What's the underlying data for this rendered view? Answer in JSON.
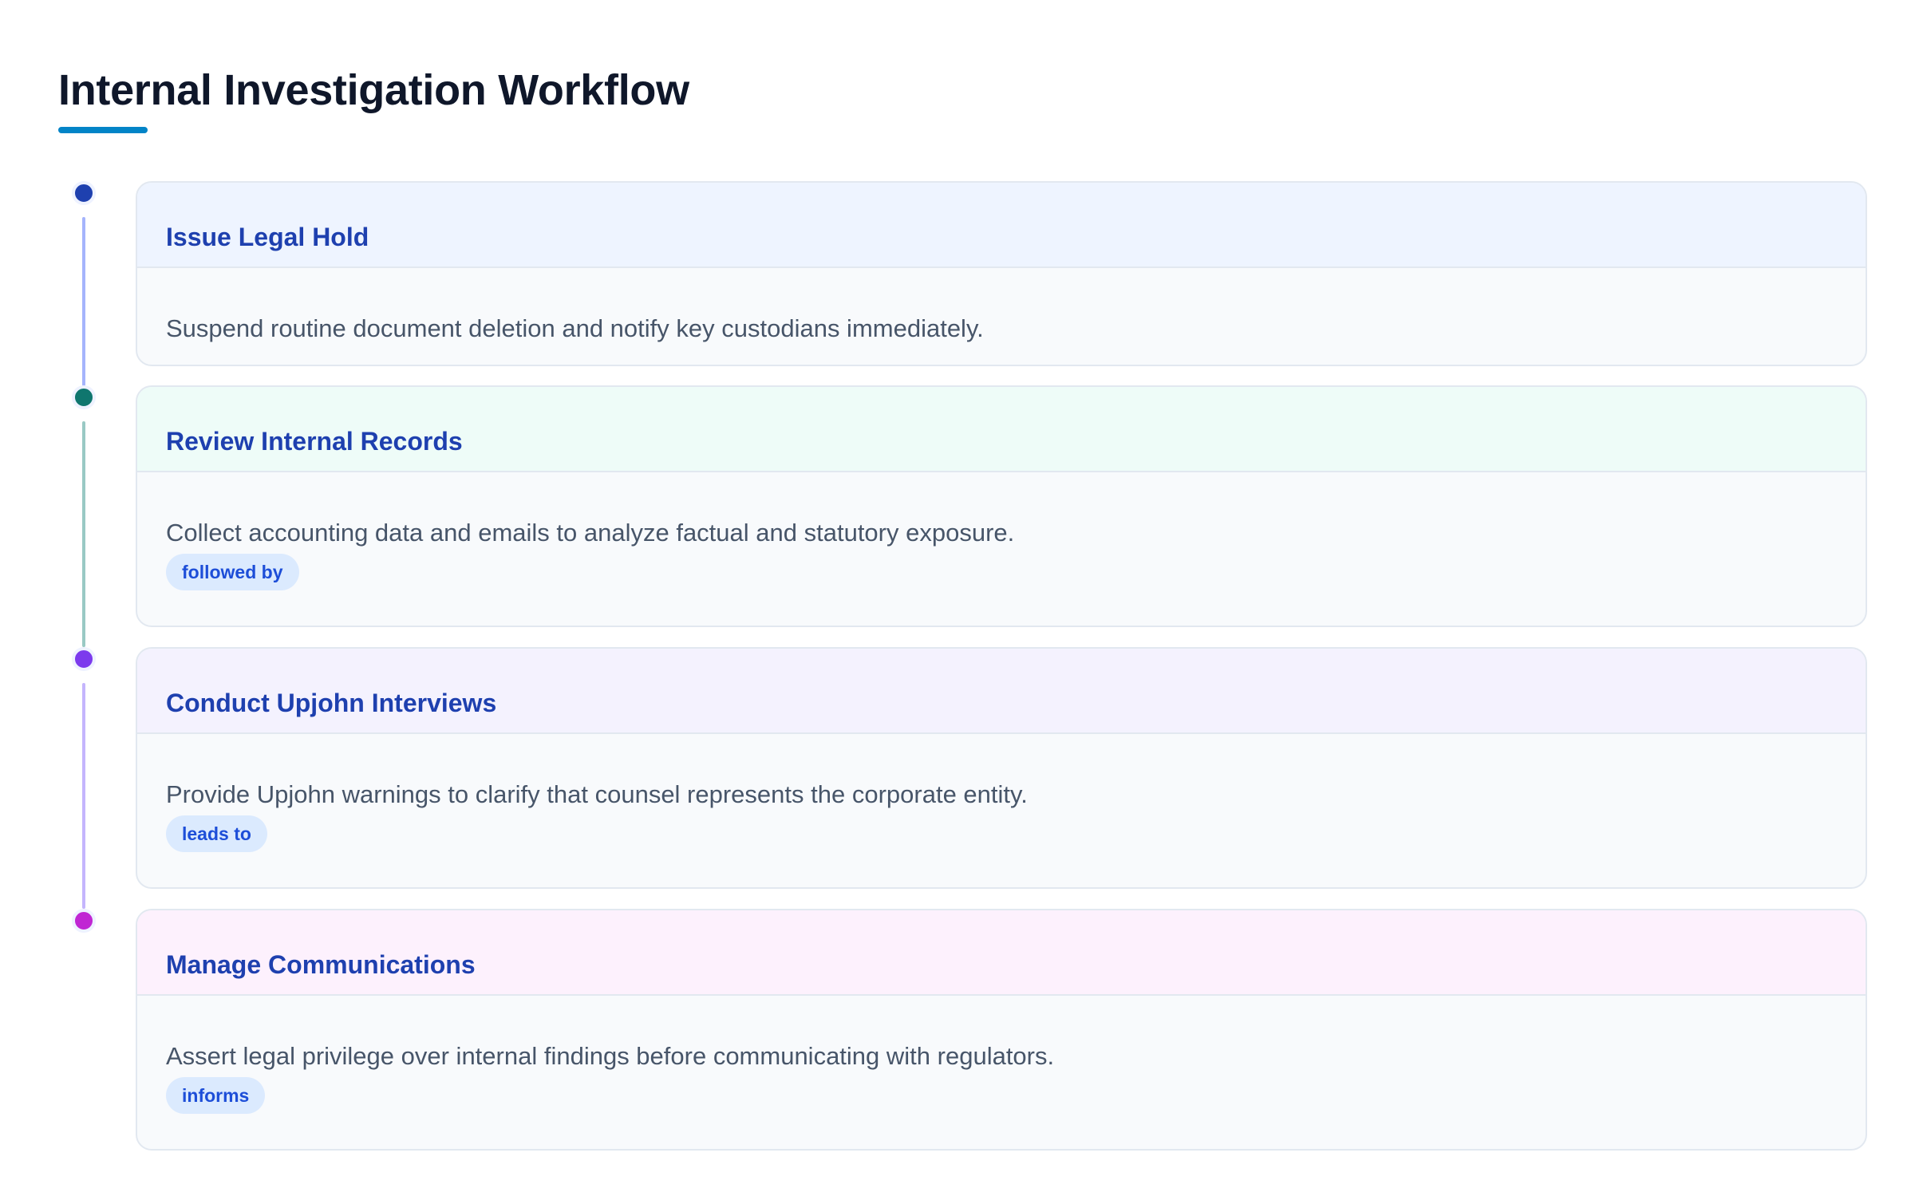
{
  "title": "Internal Investigation Workflow",
  "colors": {
    "accent": "#0284c7",
    "step_title": "#1e40af",
    "badge_bg": "#dbeafe",
    "badge_text": "#1d4ed8"
  },
  "steps": [
    {
      "title": "Issue Legal Hold",
      "description": "Suspend routine document deletion and notify key custodians immediately.",
      "dot_color": "#1e40af",
      "line_color": "#a5b4fc",
      "header_bg": "#eef4ff"
    },
    {
      "title": "Review Internal Records",
      "description": "Collect accounting data and emails to analyze factual and statutory exposure.",
      "badge": "followed by",
      "dot_color": "#0f766e",
      "line_color": "#99c9c4",
      "header_bg": "#eefcf8"
    },
    {
      "title": "Conduct Upjohn Interviews",
      "description": "Provide Upjohn warnings to clarify that counsel represents the corporate entity.",
      "badge": "leads to",
      "dot_color": "#7c3aed",
      "line_color": "#c4b5fd",
      "header_bg": "#f4f2fe"
    },
    {
      "title": "Manage Communications",
      "description": "Assert legal privilege over internal findings before communicating with regulators.",
      "badge": "informs",
      "dot_color": "#c026d3",
      "line_color": "",
      "header_bg": "#fdf1fd"
    }
  ]
}
